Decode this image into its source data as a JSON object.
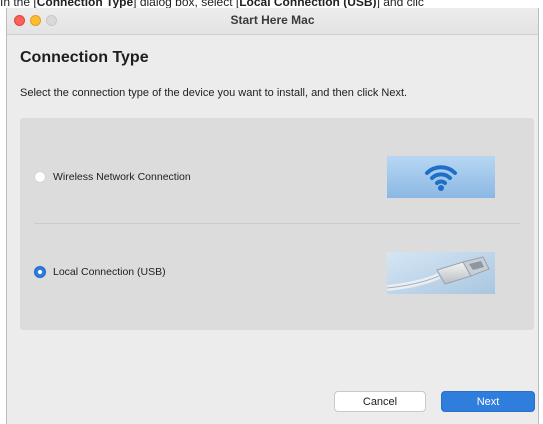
{
  "caption": {
    "prefix": "In the [",
    "dialog_name": "Connection Type",
    "middle": "] dialog box, select [",
    "selection": "Local Connection (USB)",
    "suffix": "] and clic"
  },
  "window": {
    "title": "Start Here Mac"
  },
  "dialog": {
    "heading": "Connection Type",
    "instruction": "Select the connection type of the device you want to install, and then click Next.",
    "options": [
      {
        "label": "Wireless Network Connection",
        "selected": false,
        "icon": "wifi-icon"
      },
      {
        "label": "Local Connection (USB)",
        "selected": true,
        "icon": "usb-cable-icon"
      }
    ]
  },
  "buttons": {
    "cancel_label": "Cancel",
    "next_label": "Next"
  },
  "colors": {
    "accent": "#2f7ddc",
    "close": "#fe5f57",
    "minimize": "#febc2e",
    "wifi_bg": "#9ec6ea",
    "wifi_glyph": "#1f6fc9"
  }
}
